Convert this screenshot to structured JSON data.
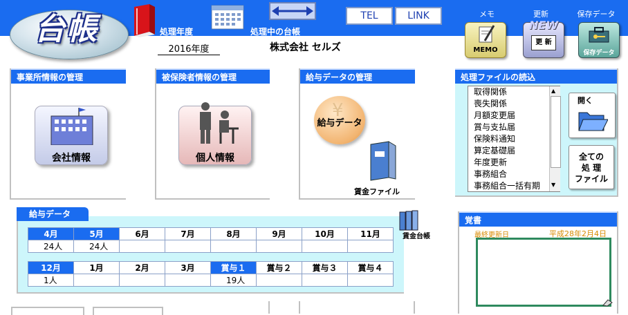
{
  "app": {
    "logo": "台帳"
  },
  "header": {
    "year_label": "処理年度",
    "current_ledger_label": "処理中の台帳",
    "tel_label": "TEL",
    "link_label": "LINK",
    "memo_caption": "メモ",
    "update_caption": "更新",
    "save_caption": "保存データ",
    "memo_icon_text": "MEMO",
    "update_icon_text": "更 新",
    "update_new_text": "NEW",
    "save_icon_text": "保存データ",
    "year_value": "2016年度",
    "company_value": "株式会社  セルズ"
  },
  "panels": {
    "office": {
      "title": "事業所情報の管理",
      "button": "会社情報"
    },
    "insured": {
      "title": "被保険者情報の管理",
      "button": "個人情報"
    },
    "salary": {
      "title": "給与データの管理",
      "button": "給与データ",
      "wage_file": "賃金ファイル"
    }
  },
  "files": {
    "title": "処理ファイルの読込",
    "items": [
      "取得関係",
      "喪失関係",
      "月額変更届",
      "賞与支払届",
      "保険料通知",
      "算定基礎届",
      "年度更新",
      "事務組合",
      "事務組合一括有期"
    ],
    "open_label": "開く",
    "all_files_label": "全ての\n処 理\nファイル"
  },
  "payroll": {
    "title": "給与データ",
    "ledger_label": "賃金台帳",
    "row1_headers": [
      "4月",
      "5月",
      "6月",
      "7月",
      "8月",
      "9月",
      "10月",
      "11月"
    ],
    "row1_values": [
      "24人",
      "24人",
      "",
      "",
      "",
      "",
      "",
      ""
    ],
    "row2_headers": [
      "12月",
      "1月",
      "2月",
      "3月",
      "賞与１",
      "賞与２",
      "賞与３",
      "賞与４"
    ],
    "row2_values": [
      "1人",
      "",
      "",
      "",
      "19人",
      "",
      "",
      ""
    ]
  },
  "memo": {
    "title": "覚書",
    "last_updated_label": "最終更新日",
    "last_updated_value": "平成28年2月4日"
  },
  "colors": {
    "primary": "#1a6cf0",
    "panel_bg": "#cdf6fb",
    "memo_border": "#2e8a5e"
  }
}
